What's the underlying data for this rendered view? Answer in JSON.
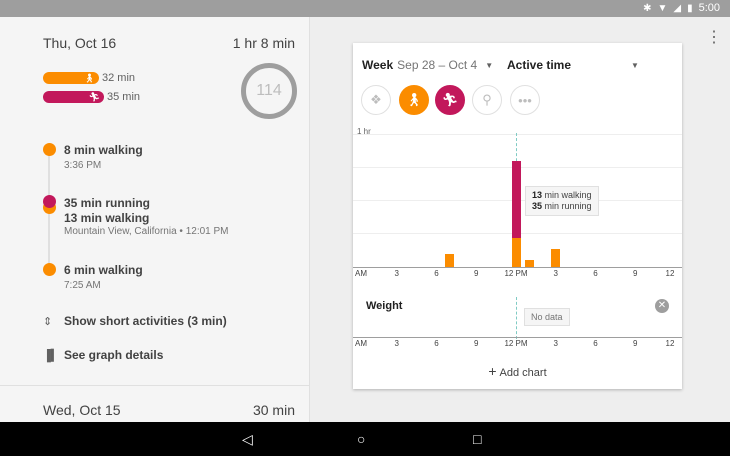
{
  "status_bar": {
    "time": "5:00",
    "icons": [
      "bluetooth-icon",
      "wifi-icon",
      "signal-icon",
      "battery-icon"
    ]
  },
  "day1": {
    "date": "Thu, Oct 16",
    "duration": "1 hr 8 min",
    "summary": [
      {
        "label": "32 min",
        "color": "#fb8c00",
        "icon": "walk-icon"
      },
      {
        "label": "35 min",
        "color": "#c2185b",
        "icon": "run-icon"
      }
    ],
    "ring_value": "114",
    "events": [
      {
        "title": "8 min walking",
        "sub": "3:36 PM"
      },
      {
        "title": "35 min running",
        "title2": "13 min walking",
        "sub": "Mountain View, California • 12:01 PM"
      },
      {
        "title": "6 min walking",
        "sub": "7:25 AM"
      }
    ],
    "actions": {
      "short_activities": "Show short activities (3 min)",
      "graph_details": "See graph details"
    }
  },
  "day2": {
    "date": "Wed, Oct 15",
    "duration": "30 min"
  },
  "card": {
    "period_label": "Week",
    "period_range": "Sep 28 – Oct 4",
    "metric_label": "Active time",
    "filters": [
      "all-activities-icon",
      "walk-icon",
      "run-icon",
      "bike-icon",
      "more-icon"
    ],
    "y_label": "1 hr",
    "x_ticks": [
      "AM",
      "3",
      "6",
      "9",
      "12 PM",
      "3",
      "6",
      "9",
      "12"
    ],
    "tooltip": {
      "walk_value": "13",
      "walk_text": "min walking",
      "run_value": "35",
      "run_text": "min running"
    },
    "weight_title": "Weight",
    "weight_nodata": "No data",
    "add_chart": "Add chart"
  },
  "chart_data": {
    "type": "bar",
    "title": "Active time",
    "ylim": [
      0,
      60
    ],
    "y_unit": "min",
    "x_ticks": [
      "AM",
      "3",
      "6",
      "9",
      "12 PM",
      "3",
      "6",
      "9",
      "12"
    ],
    "series": [
      {
        "name": "walking",
        "color": "#fb8c00",
        "values": [
          {
            "hour": 7,
            "min": 6
          },
          {
            "hour": 12,
            "min": 13
          },
          {
            "hour": 13,
            "min": 3
          },
          {
            "hour": 15,
            "min": 8
          }
        ]
      },
      {
        "name": "running",
        "color": "#c2185b",
        "values": [
          {
            "hour": 12,
            "min": 35
          }
        ]
      }
    ]
  }
}
